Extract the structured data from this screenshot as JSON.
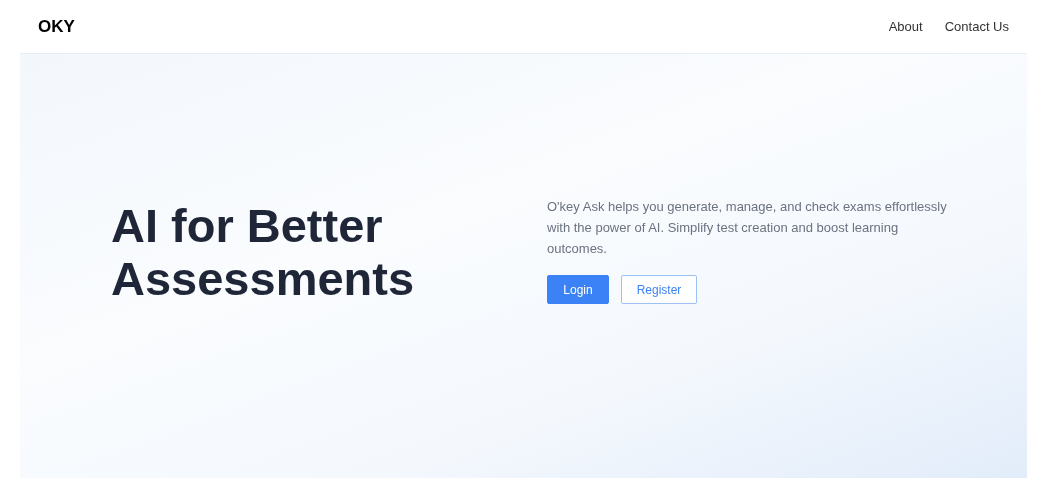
{
  "header": {
    "logo": "OKY",
    "nav": [
      "About",
      "Contact Us"
    ]
  },
  "hero": {
    "title_lines": [
      "AI for Better",
      "Assessments"
    ],
    "description": "O'key Ask helps you generate, manage, and check exams effortlessly with the power of AI. Simplify test creation and boost learning outcomes.",
    "buttons": [
      {
        "label": "Login",
        "kind": "primary"
      },
      {
        "label": "Register",
        "kind": "outline"
      }
    ]
  }
}
